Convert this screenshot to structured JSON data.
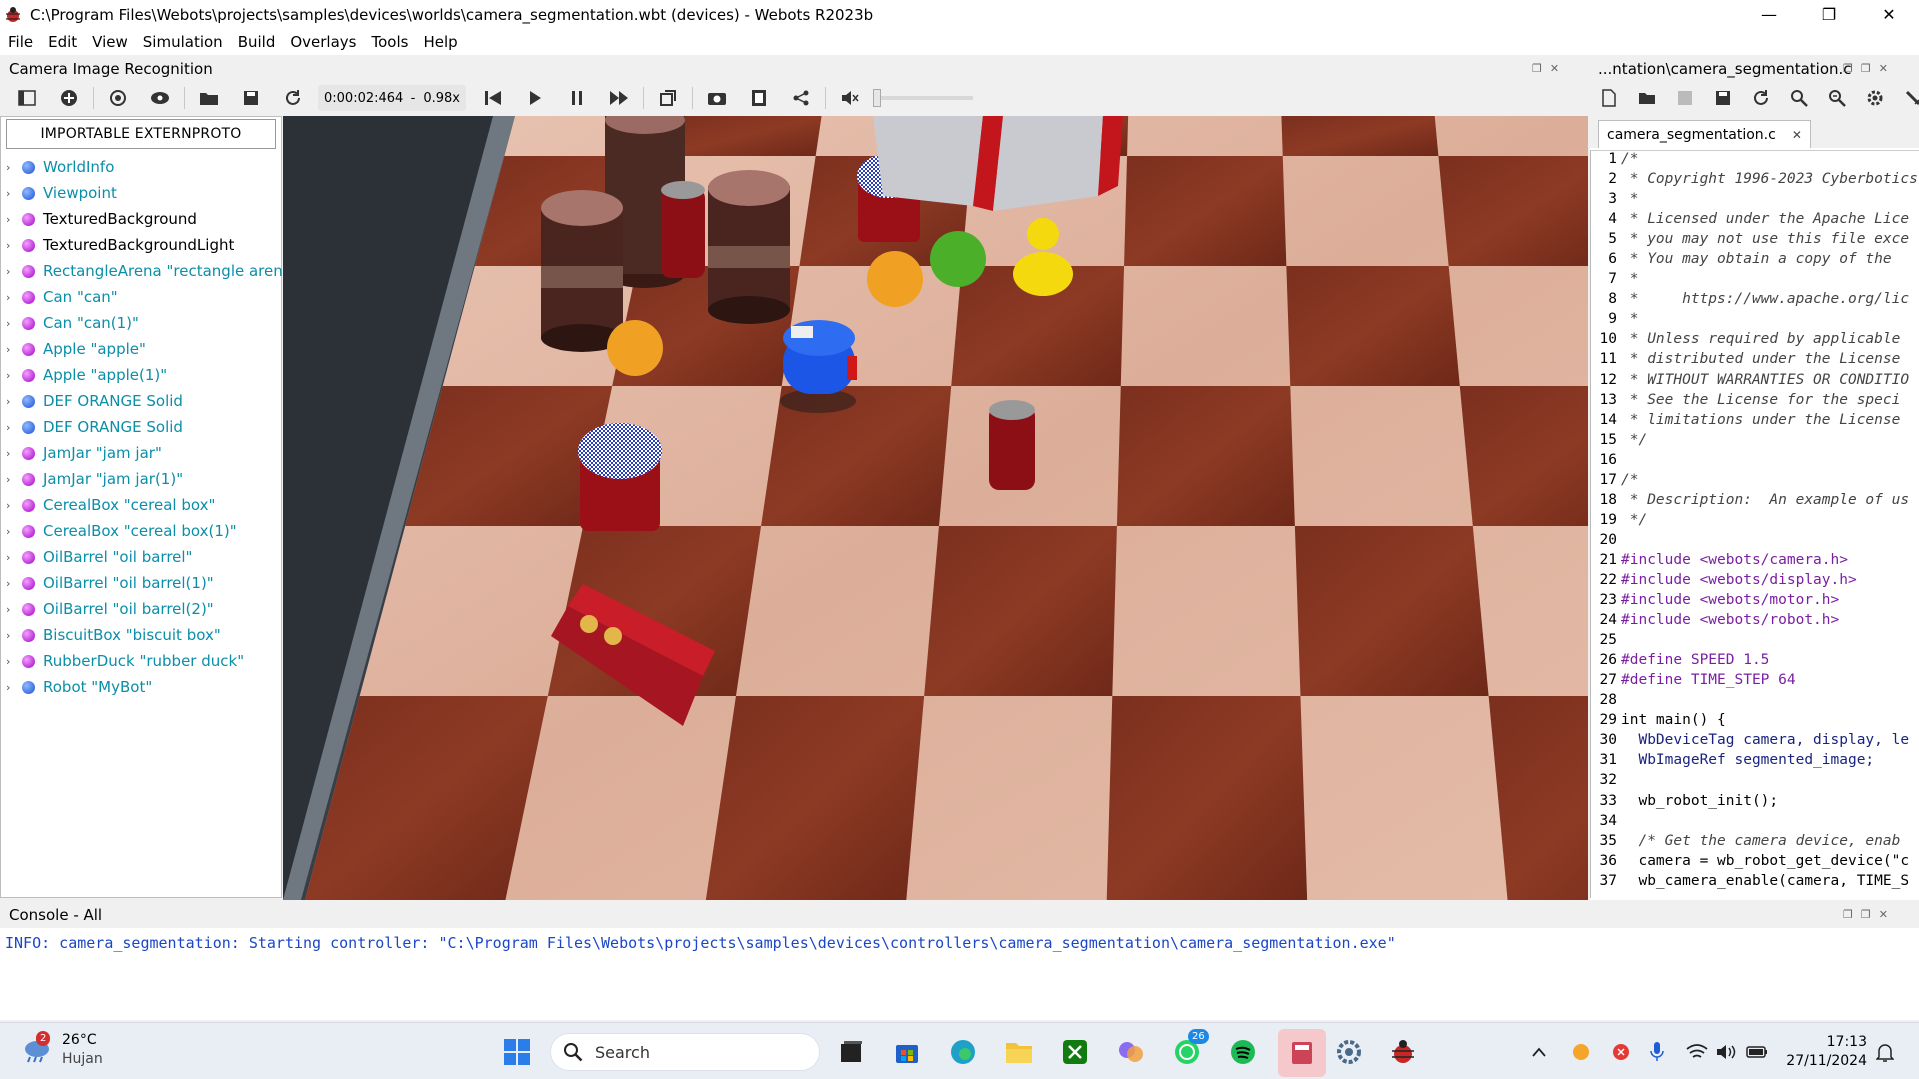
{
  "window": {
    "title": "C:\\Program Files\\Webots\\projects\\samples\\devices\\worlds\\camera_segmentation.wbt (devices) - Webots R2023b",
    "minimize": "—",
    "maximize": "❐",
    "close": "✕"
  },
  "menu": [
    "File",
    "Edit",
    "View",
    "Simulation",
    "Build",
    "Overlays",
    "Tools",
    "Help"
  ],
  "view_panel": {
    "title": "Camera Image Recognition",
    "time": "0:00:02:464",
    "speed": "0.98x",
    "speed_sep": "-"
  },
  "scene_tree": {
    "externproto_button": "IMPORTABLE EXTERNPROTO",
    "items": [
      {
        "label": "WorldInfo",
        "color": "blue",
        "link": true
      },
      {
        "label": "Viewpoint",
        "color": "blue",
        "link": true
      },
      {
        "label": "TexturedBackground",
        "color": "purple",
        "link": false
      },
      {
        "label": "TexturedBackgroundLight",
        "color": "purple",
        "link": false
      },
      {
        "label": "RectangleArena \"rectangle arena\"",
        "color": "purple",
        "link": true
      },
      {
        "label": "Can \"can\"",
        "color": "purple",
        "link": true
      },
      {
        "label": "Can \"can(1)\"",
        "color": "purple",
        "link": true
      },
      {
        "label": "Apple \"apple\"",
        "color": "purple",
        "link": true
      },
      {
        "label": "Apple \"apple(1)\"",
        "color": "purple",
        "link": true
      },
      {
        "label": "DEF ORANGE Solid",
        "color": "blue",
        "link": true
      },
      {
        "label": "DEF ORANGE Solid",
        "color": "blue",
        "link": true
      },
      {
        "label": "JamJar \"jam jar\"",
        "color": "purple",
        "link": true
      },
      {
        "label": "JamJar \"jam jar(1)\"",
        "color": "purple",
        "link": true
      },
      {
        "label": "CerealBox \"cereal box\"",
        "color": "purple",
        "link": true
      },
      {
        "label": "CerealBox \"cereal box(1)\"",
        "color": "purple",
        "link": true
      },
      {
        "label": "OilBarrel \"oil barrel\"",
        "color": "purple",
        "link": true
      },
      {
        "label": "OilBarrel \"oil barrel(1)\"",
        "color": "purple",
        "link": true
      },
      {
        "label": "OilBarrel \"oil barrel(2)\"",
        "color": "purple",
        "link": true
      },
      {
        "label": "BiscuitBox \"biscuit box\"",
        "color": "purple",
        "link": true
      },
      {
        "label": "RubberDuck \"rubber duck\"",
        "color": "purple",
        "link": true
      },
      {
        "label": "Robot \"MyBot\"",
        "color": "blue",
        "link": true
      }
    ]
  },
  "editor": {
    "panel_title": "...ntation\\camera_segmentation.c",
    "tab": "camera_segmentation.c",
    "lines": [
      {
        "n": "1",
        "t": "/*",
        "k": "com"
      },
      {
        "n": "2",
        "t": " * Copyright 1996-2023 Cyberbotics",
        "k": "com"
      },
      {
        "n": "3",
        "t": " *",
        "k": "com"
      },
      {
        "n": "4",
        "t": " * Licensed under the Apache Lice",
        "k": "com"
      },
      {
        "n": "5",
        "t": " * you may not use this file exce",
        "k": "com"
      },
      {
        "n": "6",
        "t": " * You may obtain a copy of the ",
        "k": "com"
      },
      {
        "n": "7",
        "t": " *",
        "k": "com"
      },
      {
        "n": "8",
        "t": " *     https://www.apache.org/lic",
        "k": "com"
      },
      {
        "n": "9",
        "t": " *",
        "k": "com"
      },
      {
        "n": "10",
        "t": " * Unless required by applicable",
        "k": "com"
      },
      {
        "n": "11",
        "t": " * distributed under the License",
        "k": "com"
      },
      {
        "n": "12",
        "t": " * WITHOUT WARRANTIES OR CONDITIO",
        "k": "com"
      },
      {
        "n": "13",
        "t": " * See the License for the speci",
        "k": "com"
      },
      {
        "n": "14",
        "t": " * limitations under the License",
        "k": "com"
      },
      {
        "n": "15",
        "t": " */",
        "k": "com"
      },
      {
        "n": "16",
        "t": "",
        "k": "com"
      },
      {
        "n": "17",
        "t": "/*",
        "k": "com"
      },
      {
        "n": "18",
        "t": " * Description:  An example of us",
        "k": "com"
      },
      {
        "n": "19",
        "t": " */",
        "k": "com"
      },
      {
        "n": "20",
        "t": "",
        "k": "kw"
      },
      {
        "n": "21",
        "t": "#include <webots/camera.h>",
        "k": "pre"
      },
      {
        "n": "22",
        "t": "#include <webots/display.h>",
        "k": "pre"
      },
      {
        "n": "23",
        "t": "#include <webots/motor.h>",
        "k": "pre"
      },
      {
        "n": "24",
        "t": "#include <webots/robot.h>",
        "k": "pre"
      },
      {
        "n": "25",
        "t": "",
        "k": "kw"
      },
      {
        "n": "26",
        "t": "#define SPEED 1.5",
        "k": "pre"
      },
      {
        "n": "27",
        "t": "#define TIME_STEP 64",
        "k": "pre"
      },
      {
        "n": "28",
        "t": "",
        "k": "kw"
      },
      {
        "n": "29",
        "t": "int main() {",
        "k": "kw"
      },
      {
        "n": "30",
        "t": "  WbDeviceTag camera, display, le",
        "k": "fn"
      },
      {
        "n": "31",
        "t": "  WbImageRef segmented_image;",
        "k": "fn"
      },
      {
        "n": "32",
        "t": "",
        "k": "kw"
      },
      {
        "n": "33",
        "t": "  wb_robot_init();",
        "k": "kw"
      },
      {
        "n": "34",
        "t": "",
        "k": "kw"
      },
      {
        "n": "35",
        "t": "  /* Get the camera device, enab",
        "k": "com"
      },
      {
        "n": "36",
        "t": "  camera = wb_robot_get_device(\"c",
        "k": "kw"
      },
      {
        "n": "37",
        "t": "  wb_camera_enable(camera, TIME_S",
        "k": "kw"
      }
    ]
  },
  "console": {
    "title": "Console - All",
    "message": "INFO: camera_segmentation: Starting controller: \"C:\\Program Files\\Webots\\projects\\samples\\devices\\controllers\\camera_segmentation\\camera_segmentation.exe\""
  },
  "taskbar": {
    "weather_temp": "26°C",
    "weather_desc": "Hujan",
    "weather_badge": "2",
    "search_placeholder": "Search",
    "whatsapp_badge": "26",
    "time": "17:13",
    "date": "27/11/2024"
  }
}
